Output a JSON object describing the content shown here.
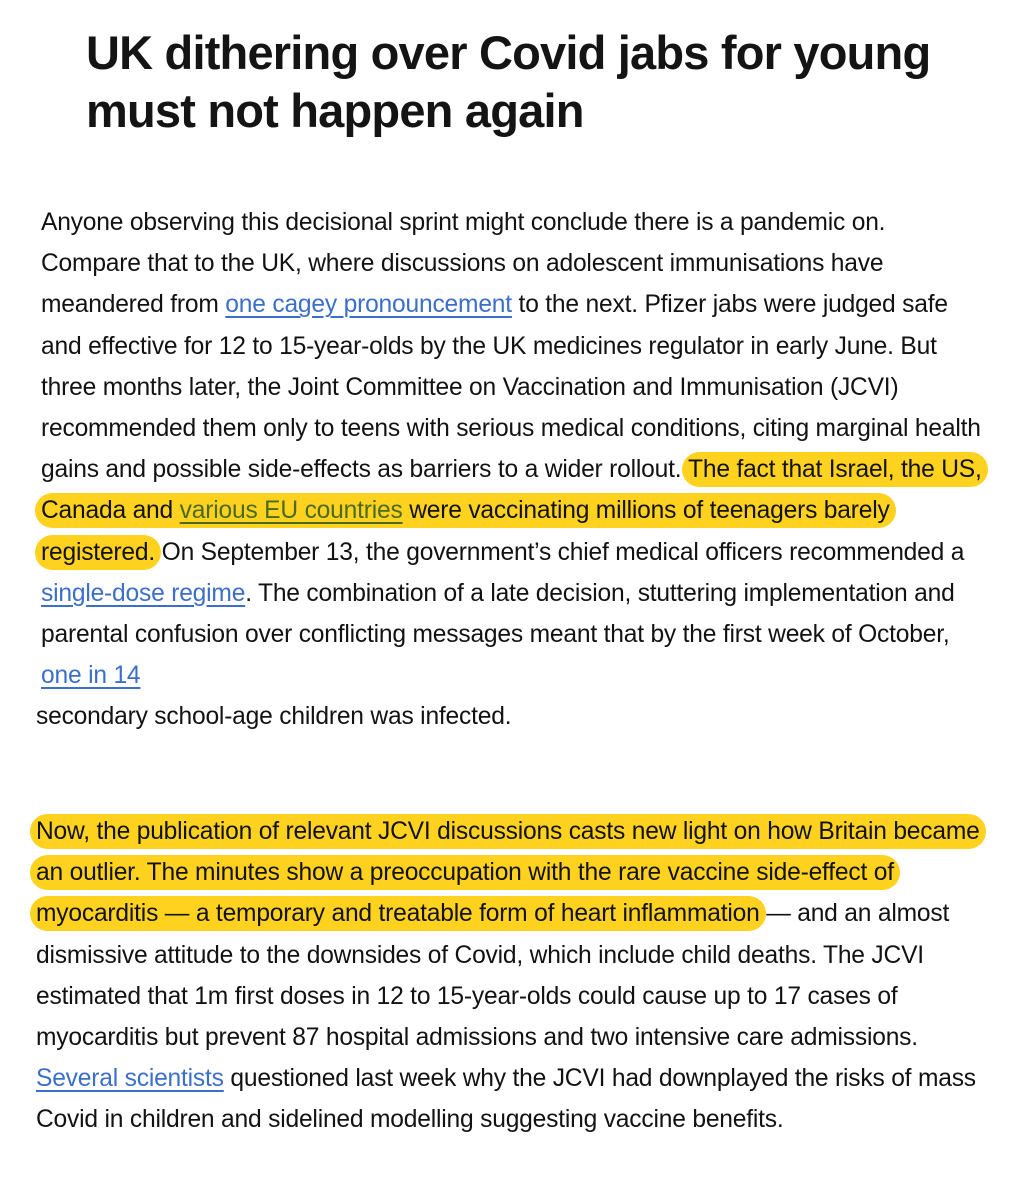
{
  "article": {
    "headline": "UK dithering over Covid jabs for young must not happen again",
    "paragraph1": {
      "t1": "Anyone observing this decisional sprint might conclude there is a pandemic on. Compare that to the UK, where discussions on adolescent immunisations have meandered from ",
      "link1": "one cagey pronouncement",
      "t2": " to the next. Pfizer jabs were judged safe and effective for 12 to 15-year-olds by the UK medicines regulator in early June. But three months later, the Joint Committee on Vaccination and Immunisation (JCVI) recommended them only to teens with serious medical conditions, citing marginal health gains and possible side-effects as barriers to a wider rollout. ",
      "hl_t1": "The fact that Israel, the US, Canada and ",
      "hl_link": "various EU countries",
      "hl_t2": " were vaccinating millions of teenagers barely registered.",
      "t3": " On September 13, the government’s chief medical officers recommended a ",
      "link2": "single-dose regime",
      "t4": ". The combination of a late decision, stuttering implementation and parental confusion over conflicting messages meant that by the first week of October, ",
      "link3": "one in 14",
      "t5": "secondary school-age children was infected."
    },
    "paragraph2": {
      "hl_text": "Now, the publication of relevant JCVI discussions casts new light on how Britain became an outlier. The minutes show a preoccupation with the rare vaccine side-effect of myocarditis — a temporary and treatable form of heart inflammation",
      "t1": " — and an almost dismissive attitude to the downsides of Covid, which include child deaths. The JCVI estimated that 1m first doses in 12 to 15-year-olds could cause up to 17 cases of myocarditis but prevent 87 hospital admissions and two intensive care admissions. ",
      "link1": "Several scientists",
      "t2": " questioned last week why the JCVI had downplayed the risks of mass Covid in children and sidelined modelling suggesting vaccine benefits."
    }
  },
  "colors": {
    "highlight": "#ffd21f",
    "link": "#3b6fc9",
    "text": "#121212"
  }
}
